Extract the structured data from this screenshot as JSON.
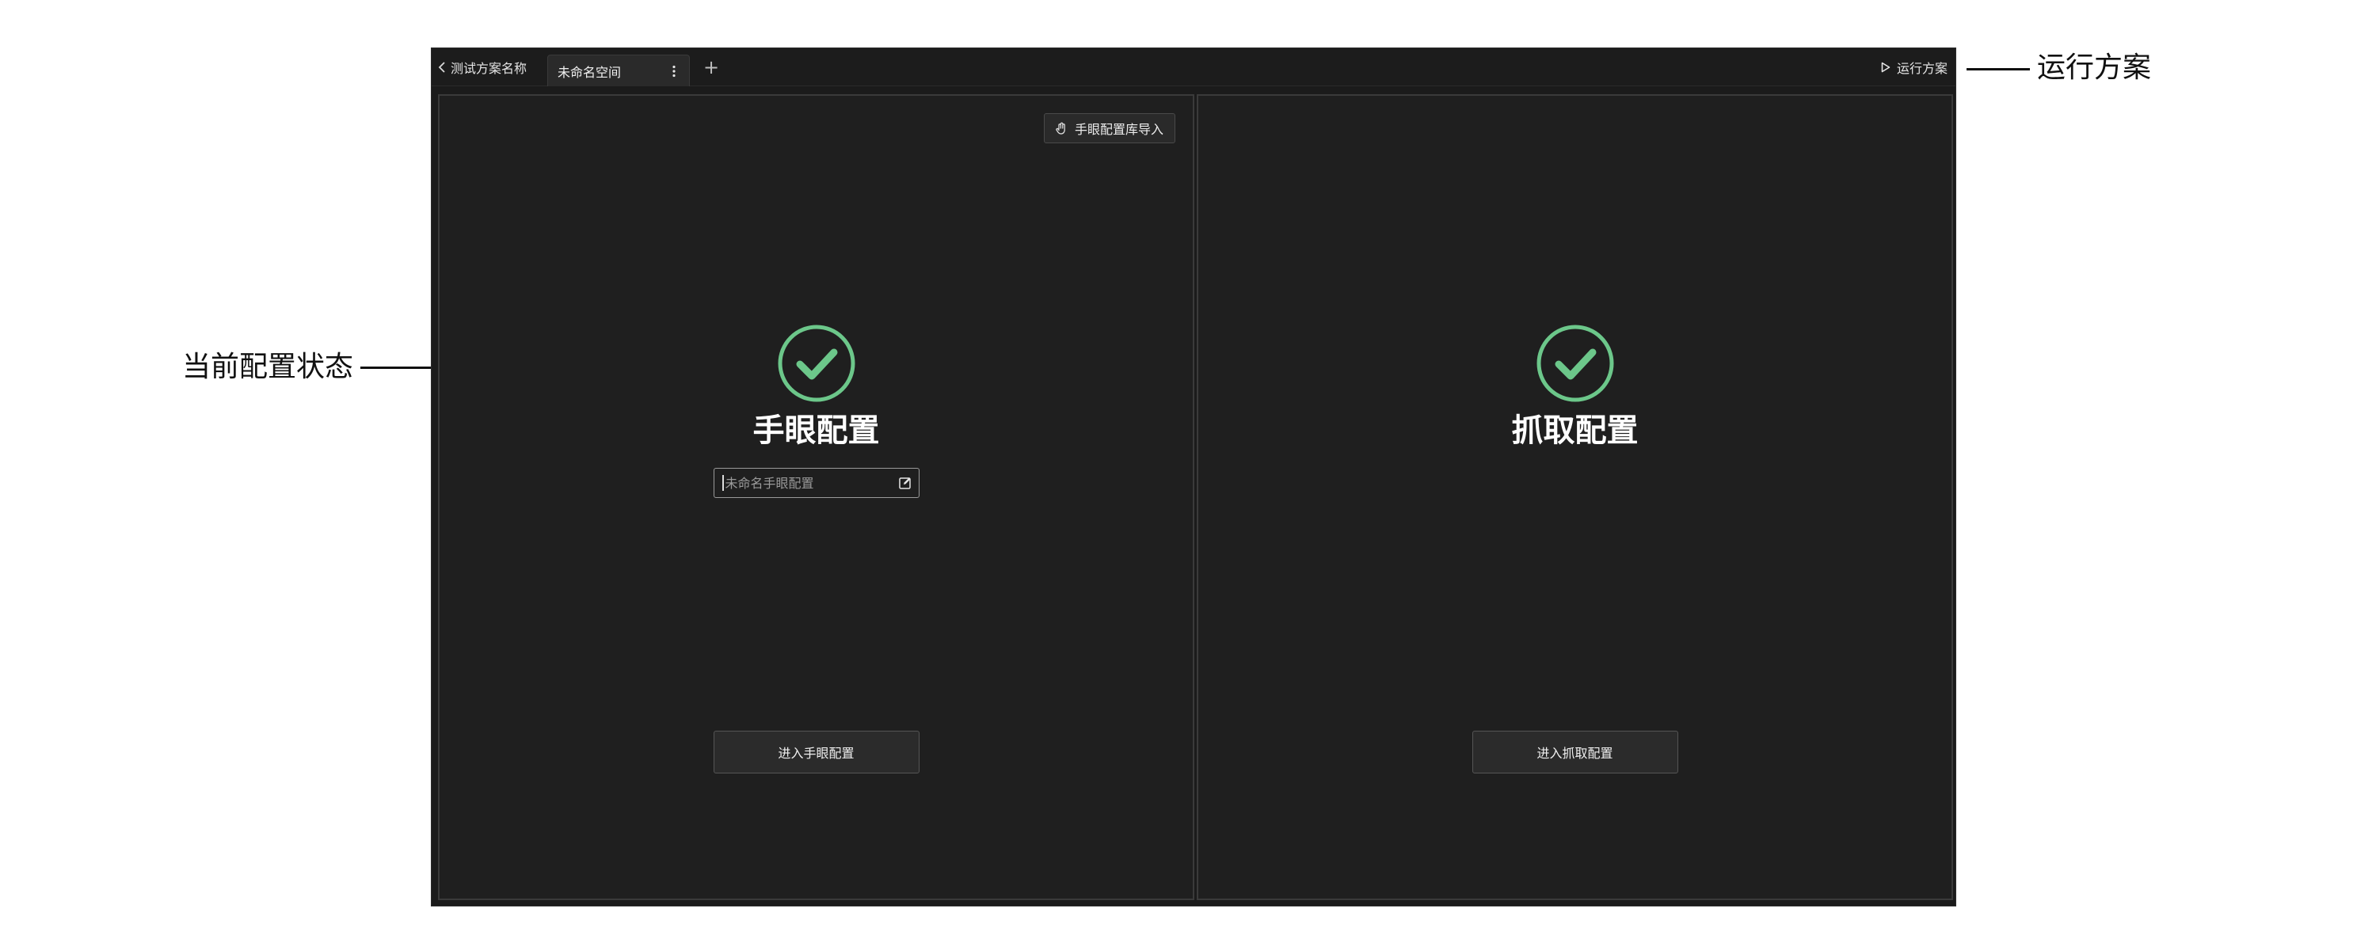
{
  "annotations": {
    "status_label": "当前配置状态",
    "run_label": "运行方案"
  },
  "topbar": {
    "back_label": "测试方案名称",
    "active_tab": "未命名空间",
    "add_tab_symbol": "+",
    "run_label": "运行方案"
  },
  "hand_eye_panel": {
    "import_button": "手眼配置库导入",
    "status": "configured",
    "title": "手眼配置",
    "name_placeholder": "未命名手眼配置",
    "enter_button": "进入手眼配置"
  },
  "grasp_panel": {
    "status": "configured",
    "title": "抓取配置",
    "enter_button": "进入抓取配置"
  },
  "colors": {
    "success": "#6cc78a",
    "background": "#1f1f1f",
    "border": "#3a3a3a"
  },
  "icons": {
    "back": "chevron-left-icon",
    "tab_menu": "vertical-dots-icon",
    "add": "plus-icon",
    "run": "play-icon",
    "import": "hand-icon",
    "status": "check-circle-icon",
    "edit": "edit-icon"
  }
}
